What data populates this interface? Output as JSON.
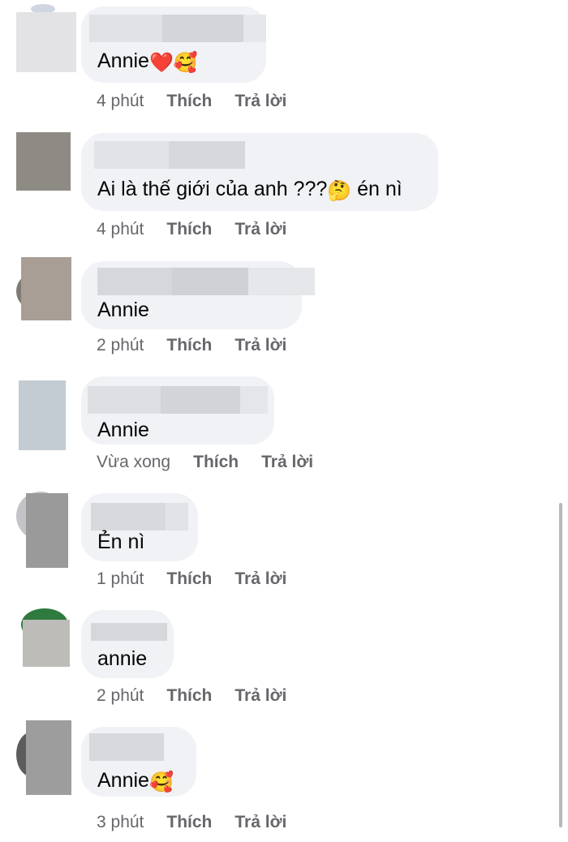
{
  "comments": [
    {
      "text": "Annie",
      "emoji": "❤️🥰",
      "time": "4 phút",
      "like": "Thích",
      "reply": "Trả lời"
    },
    {
      "text": "Ai là thế giới của anh ???",
      "emoji": "🤔",
      "text_after": " én nì",
      "time": "4 phút",
      "like": "Thích",
      "reply": "Trả lời"
    },
    {
      "text": "Annie",
      "emoji": "",
      "time": "2 phút",
      "like": "Thích",
      "reply": "Trả lời"
    },
    {
      "text": "Annie",
      "emoji": "",
      "time": "Vừa xong",
      "like": "Thích",
      "reply": "Trả lời"
    },
    {
      "text": "Ẻn nì",
      "emoji": "",
      "time": "1 phút",
      "like": "Thích",
      "reply": "Trả lời"
    },
    {
      "text": "annie",
      "emoji": "",
      "time": "2 phút",
      "like": "Thích",
      "reply": "Trả lời"
    },
    {
      "text": "Annie",
      "emoji": "🥰",
      "time": "3 phút",
      "like": "Thích",
      "reply": "Trả lời"
    }
  ],
  "colors": {
    "bubble": "#f0f2f5",
    "text": "#050505",
    "meta": "#65676b"
  }
}
